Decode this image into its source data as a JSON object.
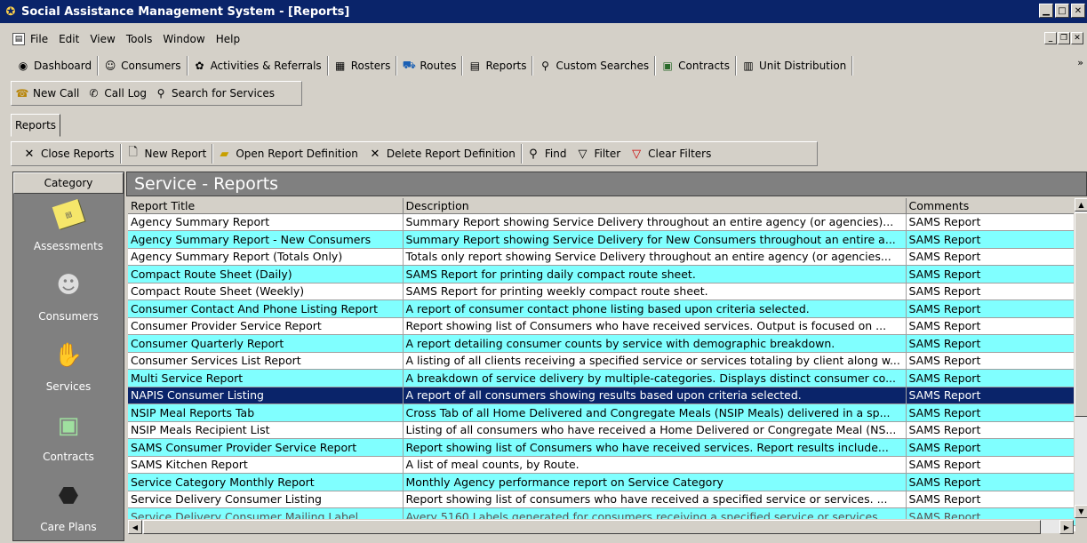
{
  "window": {
    "title": "Social Assistance Management System - [Reports]",
    "controls": [
      "minimize",
      "maximize",
      "close"
    ]
  },
  "menu": {
    "items": [
      "File",
      "Edit",
      "View",
      "Tools",
      "Window",
      "Help"
    ]
  },
  "main_toolbar": {
    "items": [
      {
        "label": "Dashboard",
        "icon": "dashboard-icon"
      },
      {
        "label": "Consumers",
        "icon": "consumers-icon"
      },
      {
        "label": "Activities & Referrals",
        "icon": "activities-icon"
      },
      {
        "label": "Rosters",
        "icon": "rosters-icon"
      },
      {
        "label": "Routes",
        "icon": "routes-icon"
      },
      {
        "label": "Reports",
        "icon": "reports-icon"
      },
      {
        "label": "Custom Searches",
        "icon": "binoculars-icon"
      },
      {
        "label": "Contracts",
        "icon": "contracts-icon"
      },
      {
        "label": "Unit Distribution",
        "icon": "unit-distribution-icon"
      }
    ]
  },
  "call_toolbar": {
    "items": [
      {
        "label": "New Call",
        "icon": "phone-icon"
      },
      {
        "label": "Call Log",
        "icon": "call-log-icon"
      },
      {
        "label": "Search for Services",
        "icon": "binoculars-icon"
      }
    ]
  },
  "tabs": [
    "Reports"
  ],
  "reports_toolbar": {
    "items": [
      {
        "label": "Close Reports",
        "icon": "close-icon"
      },
      {
        "label": "New Report",
        "icon": "new-document-icon"
      },
      {
        "label": "Open Report Definition",
        "icon": "open-folder-icon"
      },
      {
        "label": "Delete Report Definition",
        "icon": "delete-icon"
      },
      {
        "label": "Find",
        "icon": "find-icon"
      },
      {
        "label": "Filter",
        "icon": "filter-icon"
      },
      {
        "label": "Clear Filters",
        "icon": "clear-filter-icon"
      }
    ]
  },
  "sidebar": {
    "header": "Category",
    "items": [
      {
        "label": "Assessments",
        "icon": "sticky-note-icon"
      },
      {
        "label": "Consumers",
        "icon": "person-icon"
      },
      {
        "label": "Services",
        "icon": "handshake-icon"
      },
      {
        "label": "Contracts",
        "icon": "contract-certificate-icon"
      },
      {
        "label": "Care Plans",
        "icon": "care-plan-icon"
      }
    ]
  },
  "section_title": "Service - Reports",
  "table": {
    "columns": [
      "Report Title",
      "Description",
      "Comments"
    ],
    "rows": [
      {
        "title": "Agency Summary Report",
        "description": "Summary Report showing Service Delivery throughout an entire agency (or agencies)...",
        "comments": "SAMS Report"
      },
      {
        "title": "Agency Summary Report - New Consumers",
        "description": "Summary Report showing Service Delivery for New Consumers throughout an entire a...",
        "comments": "SAMS Report"
      },
      {
        "title": "Agency Summary Report (Totals Only)",
        "description": "Totals only report showing Service Delivery throughout an entire agency (or agencies...",
        "comments": "SAMS Report"
      },
      {
        "title": "Compact Route Sheet (Daily)",
        "description": "SAMS Report for printing daily compact route sheet.",
        "comments": "SAMS Report"
      },
      {
        "title": "Compact Route Sheet (Weekly)",
        "description": "SAMS Report for printing weekly compact route sheet.",
        "comments": "SAMS Report"
      },
      {
        "title": "Consumer Contact And Phone Listing Report",
        "description": "A report of consumer contact phone listing based upon criteria selected.",
        "comments": "SAMS Report"
      },
      {
        "title": "Consumer Provider Service Report",
        "description": "Report showing list of Consumers who have received services.  Output is focused on ...",
        "comments": "SAMS Report"
      },
      {
        "title": "Consumer Quarterly Report",
        "description": "A report detailing consumer counts by service with demographic breakdown.",
        "comments": "SAMS Report"
      },
      {
        "title": "Consumer Services List Report",
        "description": "A listing of all clients receiving a specified service or services totaling by client along w...",
        "comments": "SAMS Report"
      },
      {
        "title": "Multi Service Report",
        "description": "A breakdown of service delivery by multiple-categories.  Displays distinct consumer co...",
        "comments": "SAMS Report"
      },
      {
        "title": "NAPIS Consumer Listing",
        "description": "A report of all consumers showing results based upon criteria selected.",
        "comments": "SAMS Report"
      },
      {
        "title": "NSIP Meal Reports Tab",
        "description": "Cross Tab of all Home Delivered and Congregate Meals (NSIP Meals) delivered in a sp...",
        "comments": "SAMS Report"
      },
      {
        "title": "NSIP Meals Recipient List",
        "description": "Listing of all consumers who have received a Home Delivered or Congregate Meal (NS...",
        "comments": "SAMS Report"
      },
      {
        "title": "SAMS Consumer Provider Service Report",
        "description": "Report showing list of Consumers who have received services.  Report results include...",
        "comments": "SAMS Report"
      },
      {
        "title": "SAMS Kitchen Report",
        "description": "A list of meal counts, by Route.",
        "comments": "SAMS Report"
      },
      {
        "title": "Service Category Monthly Report",
        "description": "Monthly Agency performance report on Service Category",
        "comments": "SAMS Report"
      },
      {
        "title": "Service Delivery Consumer Listing",
        "description": "Report showing list of consumers who have received a specified service or services.  ...",
        "comments": "SAMS Report"
      },
      {
        "title": "Service Delivery Consumer Mailing Label",
        "description": "Avery 5160 Labels generated for consumers receiving a specified service or services",
        "comments": "SAMS Report"
      }
    ],
    "selected_index": 10
  },
  "colors": {
    "title_bar": "#0a246a",
    "alt_row": "#80ffff",
    "selected_row": "#0a246a",
    "panel_gray": "#808080"
  }
}
